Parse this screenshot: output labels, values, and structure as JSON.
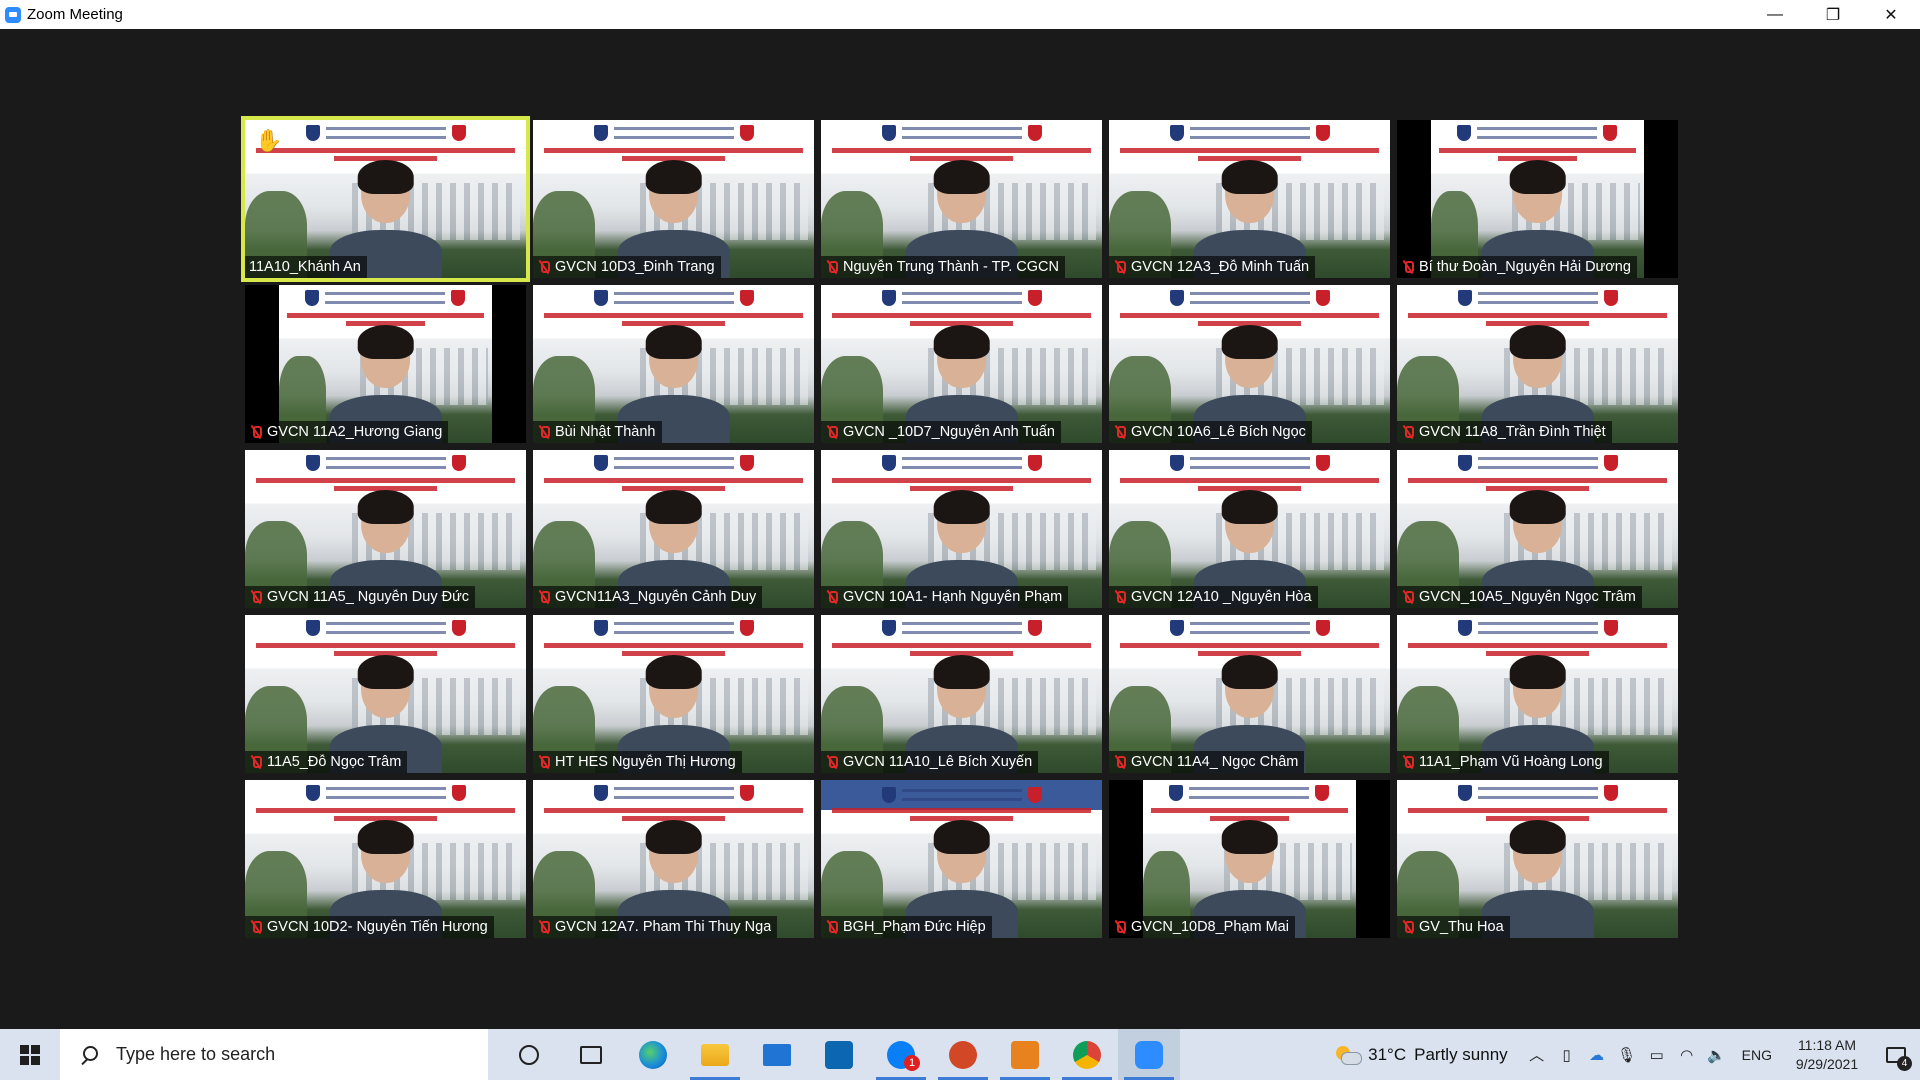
{
  "window": {
    "title": "Zoom Meeting",
    "controls": {
      "minimize": "—",
      "restore": "❐",
      "close": "✕"
    }
  },
  "participants": [
    {
      "name": "11A10_Khánh An",
      "muted": false,
      "hand_raised": true,
      "active": true
    },
    {
      "name": "GVCN 10D3_Đinh Trang",
      "muted": true
    },
    {
      "name": "Nguyễn Trung Thành - TP. CGCN",
      "muted": true
    },
    {
      "name": "GVCN 12A3_Đỗ Minh Tuấn",
      "muted": true
    },
    {
      "name": "Bí thư Đoàn_Nguyễn Hải Dương",
      "muted": true
    },
    {
      "name": "GVCN 11A2_Hương Giang",
      "muted": true
    },
    {
      "name": "Bùi Nhật Thành",
      "muted": true
    },
    {
      "name": "GVCN _10D7_Nguyễn Anh Tuấn",
      "muted": true
    },
    {
      "name": "GVCN 10A6_Lê Bích Ngọc",
      "muted": true
    },
    {
      "name": "GVCN 11A8_Trần Đình Thiệt",
      "muted": true
    },
    {
      "name": "GVCN 11A5_ Nguyễn Duy Đức",
      "muted": true
    },
    {
      "name": "GVCN11A3_Nguyễn Cảnh Duy",
      "muted": true
    },
    {
      "name": "GVCN 10A1- Hạnh Nguyễn Phạm",
      "muted": true
    },
    {
      "name": "GVCN 12A10 _Nguyễn Hòa",
      "muted": true
    },
    {
      "name": "GVCN_10A5_Nguyễn Ngọc Trâm",
      "muted": true
    },
    {
      "name": "11A5_Đỗ Ngọc Trâm",
      "muted": true
    },
    {
      "name": "HT HES Nguyễn Thị Hương",
      "muted": true
    },
    {
      "name": "GVCN 11A10_Lê Bích Xuyến",
      "muted": true
    },
    {
      "name": "GVCN 11A4_ Ngọc Châm",
      "muted": true
    },
    {
      "name": "11A1_Phạm Vũ Hoàng Long",
      "muted": true
    },
    {
      "name": "GVCN 10D2- Nguyễn Tiến Hương",
      "muted": true
    },
    {
      "name": "GVCN 12A7. Pham Thi Thuy Nga",
      "muted": true
    },
    {
      "name": "BGH_Phạm Đức Hiệp",
      "muted": true
    },
    {
      "name": "GVCN_10D8_Phạm Mai",
      "muted": true
    },
    {
      "name": "GV_Thu Hoa",
      "muted": true
    }
  ],
  "taskbar": {
    "search_placeholder": "Type here to search",
    "apps": [
      "cortana-icon",
      "task-view-icon",
      "edge-icon",
      "file-explorer-icon",
      "mail-icon",
      "dell-icon",
      "zalo-icon",
      "powerpoint-icon",
      "pdf-icon",
      "chrome-icon",
      "zoom-icon"
    ],
    "zalo_badge": "1",
    "weather": {
      "temp": "31°C",
      "condition": "Partly sunny"
    },
    "language": "ENG",
    "time": "11:18 AM",
    "date": "9/29/2021",
    "notification_count": "4"
  },
  "colors": {
    "active_speaker_border": "#d6e84a",
    "muted_icon": "#e02828",
    "meeting_background": "#1a1a1a",
    "zoom_blue": "#2d8cff"
  }
}
